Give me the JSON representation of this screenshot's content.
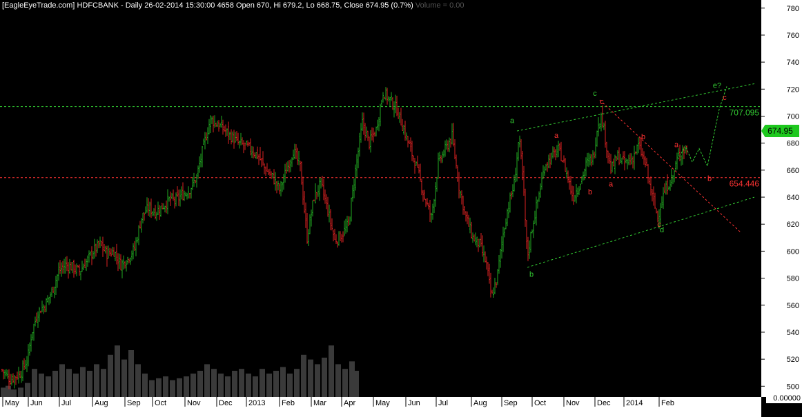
{
  "header": {
    "source": "[EagleEyeTrade.com]",
    "symbol": "HDFCBANK",
    "ohlc_text": "- Daily 26-02-2014 15:30:00 4658 Open 670, Hi 679.2, Lo 668.75, Close 674.95 (0.7%)",
    "volume_text": "Volume = 0.00"
  },
  "last_price_label": "674.95",
  "volume_axis_label": "0.00000",
  "colors": {
    "background": "#000000",
    "up": "#22aa22",
    "down": "#dd2222",
    "level_green": "#33cc33",
    "level_red": "#ff3333",
    "volume": "#3a3a3a",
    "axis_panel": "#ffffff"
  },
  "chart_data": {
    "type": "candlestick",
    "ylim": [
      492,
      786
    ],
    "y_ticks": [
      500,
      520,
      540,
      560,
      580,
      600,
      620,
      640,
      660,
      680,
      700,
      720,
      740,
      760,
      780
    ],
    "x_range": [
      0,
      1100
    ],
    "month_ticks": [
      {
        "label": "May",
        "x": 4
      },
      {
        "label": "Jun",
        "x": 41
      },
      {
        "label": "Jul",
        "x": 86
      },
      {
        "label": "Aug",
        "x": 134
      },
      {
        "label": "Sep",
        "x": 181
      },
      {
        "label": "Oct",
        "x": 221
      },
      {
        "label": "Nov",
        "x": 268
      },
      {
        "label": "Dec",
        "x": 314
      },
      {
        "label": "2013",
        "x": 357
      },
      {
        "label": "Feb",
        "x": 405
      },
      {
        "label": "Mar",
        "x": 451
      },
      {
        "label": "Apr",
        "x": 495
      },
      {
        "label": "May",
        "x": 541
      },
      {
        "label": "Jun",
        "x": 588
      },
      {
        "label": "Jul",
        "x": 632
      },
      {
        "label": "Aug",
        "x": 683
      },
      {
        "label": "Sep",
        "x": 727
      },
      {
        "label": "Oct",
        "x": 771
      },
      {
        "label": "Nov",
        "x": 817
      },
      {
        "label": "Dec",
        "x": 862
      },
      {
        "label": "2014",
        "x": 904
      },
      {
        "label": "Feb",
        "x": 955
      }
    ],
    "price_path": [
      [
        3,
        512
      ],
      [
        15,
        505
      ],
      [
        30,
        510
      ],
      [
        40,
        520
      ],
      [
        46,
        540
      ],
      [
        55,
        555
      ],
      [
        65,
        560
      ],
      [
        75,
        570
      ],
      [
        85,
        585
      ],
      [
        95,
        590
      ],
      [
        105,
        588
      ],
      [
        115,
        585
      ],
      [
        125,
        592
      ],
      [
        135,
        600
      ],
      [
        145,
        605
      ],
      [
        155,
        598
      ],
      [
        165,
        600
      ],
      [
        175,
        590
      ],
      [
        185,
        595
      ],
      [
        195,
        602
      ],
      [
        205,
        625
      ],
      [
        215,
        632
      ],
      [
        225,
        629
      ],
      [
        235,
        633
      ],
      [
        245,
        638
      ],
      [
        255,
        638
      ],
      [
        265,
        642
      ],
      [
        275,
        646
      ],
      [
        285,
        655
      ],
      [
        295,
        678
      ],
      [
        305,
        698
      ],
      [
        315,
        694
      ],
      [
        325,
        690
      ],
      [
        335,
        685
      ],
      [
        345,
        680
      ],
      [
        355,
        678
      ],
      [
        365,
        675
      ],
      [
        375,
        670
      ],
      [
        385,
        660
      ],
      [
        395,
        655
      ],
      [
        405,
        645
      ],
      [
        415,
        660
      ],
      [
        425,
        675
      ],
      [
        435,
        662
      ],
      [
        445,
        610
      ],
      [
        455,
        640
      ],
      [
        465,
        650
      ],
      [
        475,
        630
      ],
      [
        485,
        608
      ],
      [
        495,
        612
      ],
      [
        505,
        620
      ],
      [
        515,
        660
      ],
      [
        525,
        695
      ],
      [
        535,
        680
      ],
      [
        545,
        690
      ],
      [
        555,
        718
      ],
      [
        565,
        712
      ],
      [
        575,
        705
      ],
      [
        585,
        690
      ],
      [
        595,
        675
      ],
      [
        605,
        660
      ],
      [
        615,
        640
      ],
      [
        625,
        625
      ],
      [
        635,
        665
      ],
      [
        645,
        675
      ],
      [
        655,
        685
      ],
      [
        665,
        648
      ],
      [
        675,
        625
      ],
      [
        685,
        610
      ],
      [
        695,
        605
      ],
      [
        705,
        590
      ],
      [
        712,
        565
      ],
      [
        720,
        580
      ],
      [
        728,
        610
      ],
      [
        735,
        630
      ],
      [
        745,
        650
      ],
      [
        752,
        685
      ],
      [
        758,
        650
      ],
      [
        764,
        595
      ],
      [
        770,
        615
      ],
      [
        780,
        640
      ],
      [
        790,
        665
      ],
      [
        800,
        670
      ],
      [
        810,
        675
      ],
      [
        820,
        660
      ],
      [
        830,
        640
      ],
      [
        840,
        650
      ],
      [
        850,
        665
      ],
      [
        860,
        670
      ],
      [
        866,
        695
      ],
      [
        872,
        700
      ],
      [
        878,
        680
      ],
      [
        885,
        660
      ],
      [
        895,
        670
      ],
      [
        905,
        665
      ],
      [
        915,
        668
      ],
      [
        925,
        678
      ],
      [
        935,
        665
      ],
      [
        945,
        640
      ],
      [
        953,
        625
      ],
      [
        960,
        640
      ],
      [
        968,
        650
      ],
      [
        975,
        655
      ],
      [
        982,
        670
      ],
      [
        990,
        675
      ],
      [
        1000,
        674.95
      ]
    ],
    "volume_bars": [
      [
        5,
        0.1
      ],
      [
        12,
        0.12
      ],
      [
        20,
        0.08
      ],
      [
        30,
        0.1
      ],
      [
        40,
        0.15
      ],
      [
        50,
        0.3
      ],
      [
        60,
        0.25
      ],
      [
        70,
        0.22
      ],
      [
        80,
        0.28
      ],
      [
        90,
        0.35
      ],
      [
        100,
        0.3
      ],
      [
        110,
        0.25
      ],
      [
        120,
        0.32
      ],
      [
        130,
        0.28
      ],
      [
        140,
        0.35
      ],
      [
        150,
        0.3
      ],
      [
        160,
        0.45
      ],
      [
        170,
        0.55
      ],
      [
        180,
        0.4
      ],
      [
        190,
        0.5
      ],
      [
        200,
        0.35
      ],
      [
        210,
        0.25
      ],
      [
        220,
        0.18
      ],
      [
        230,
        0.2
      ],
      [
        240,
        0.22
      ],
      [
        250,
        0.18
      ],
      [
        260,
        0.2
      ],
      [
        270,
        0.22
      ],
      [
        280,
        0.25
      ],
      [
        290,
        0.28
      ],
      [
        300,
        0.35
      ],
      [
        310,
        0.3
      ],
      [
        320,
        0.25
      ],
      [
        330,
        0.22
      ],
      [
        340,
        0.28
      ],
      [
        350,
        0.3
      ],
      [
        360,
        0.25
      ],
      [
        370,
        0.22
      ],
      [
        380,
        0.3
      ],
      [
        390,
        0.25
      ],
      [
        400,
        0.28
      ],
      [
        410,
        0.32
      ],
      [
        420,
        0.25
      ],
      [
        430,
        0.3
      ],
      [
        440,
        0.45
      ],
      [
        450,
        0.4
      ],
      [
        460,
        0.35
      ],
      [
        470,
        0.42
      ],
      [
        480,
        0.55
      ],
      [
        490,
        0.35
      ],
      [
        500,
        0.3
      ],
      [
        510,
        0.38
      ],
      [
        516,
        0.28
      ]
    ],
    "horizontal_levels": [
      {
        "value": 707.095,
        "label": "707.095",
        "color": "green"
      },
      {
        "value": 654.446,
        "label": "654.446",
        "color": "red"
      }
    ],
    "trendlines": [
      {
        "color": "green",
        "points": [
          [
            749,
            689
          ],
          [
            1093,
            724
          ]
        ]
      },
      {
        "color": "green",
        "points": [
          [
            764,
            588
          ],
          [
            1093,
            640
          ]
        ]
      },
      {
        "color": "red",
        "points": [
          [
            869,
            712
          ],
          [
            1073,
            614
          ]
        ]
      }
    ],
    "projection_path": [
      [
        982,
        668
      ],
      [
        993,
        678
      ],
      [
        1003,
        666
      ],
      [
        1013,
        676
      ],
      [
        1025,
        663
      ],
      [
        1042,
        705
      ],
      [
        1053,
        722
      ]
    ],
    "wave_labels": [
      {
        "text": "a",
        "x": 742,
        "y": 697,
        "color": "green"
      },
      {
        "text": "b",
        "x": 770,
        "y": 583,
        "color": "green"
      },
      {
        "text": "c",
        "x": 862,
        "y": 717,
        "color": "green"
      },
      {
        "text": "d",
        "x": 959,
        "y": 616,
        "color": "green"
      },
      {
        "text": "e?",
        "x": 1039,
        "y": 723,
        "color": "green"
      },
      {
        "text": "a",
        "x": 806,
        "y": 686,
        "color": "red"
      },
      {
        "text": "b",
        "x": 855,
        "y": 644,
        "color": "red"
      },
      {
        "text": "c",
        "x": 872,
        "y": 711,
        "color": "red"
      },
      {
        "text": "a",
        "x": 885,
        "y": 650,
        "color": "red"
      },
      {
        "text": "b",
        "x": 932,
        "y": 685,
        "color": "red"
      },
      {
        "text": "c",
        "x": 955,
        "y": 620,
        "color": "red"
      },
      {
        "text": "a",
        "x": 980,
        "y": 679,
        "color": "red"
      },
      {
        "text": "b",
        "x": 1028,
        "y": 654,
        "color": "red"
      },
      {
        "text": "c",
        "x": 1050,
        "y": 714,
        "color": "red"
      }
    ]
  }
}
